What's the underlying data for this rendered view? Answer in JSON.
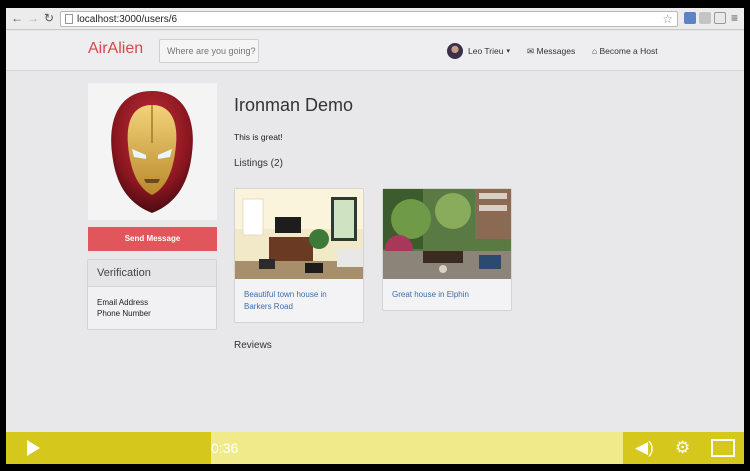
{
  "browser": {
    "url": "localhost:3000/users/6",
    "back_icon": "back-arrow-icon",
    "forward_icon": "forward-arrow-icon",
    "reload_icon": "reload-icon"
  },
  "navbar": {
    "brand": "AirAlien",
    "search_placeholder": "Where are you going?",
    "user_name": "Leo Trieu",
    "messages_label": "Messages",
    "host_label": "Become a Host"
  },
  "profile": {
    "name": "Ironman Demo",
    "about": "This is great!",
    "send_message_label": "Send Message",
    "verification": {
      "title": "Verification",
      "items": [
        "Email Address",
        "Phone Number"
      ]
    },
    "listings_heading": "Listings (2)",
    "listings": [
      {
        "title": "Beautiful town house in Barkers Road"
      },
      {
        "title": "Great house in Elphin"
      }
    ],
    "reviews_heading": "Reviews"
  },
  "player": {
    "current_time": "0:36",
    "progress": 0.27
  },
  "colors": {
    "brand": "#d9464a",
    "send_button": "#e1565b",
    "link": "#3a6fb0",
    "player_accent": "#d6c71c",
    "player_track": "#f0ea8a"
  }
}
